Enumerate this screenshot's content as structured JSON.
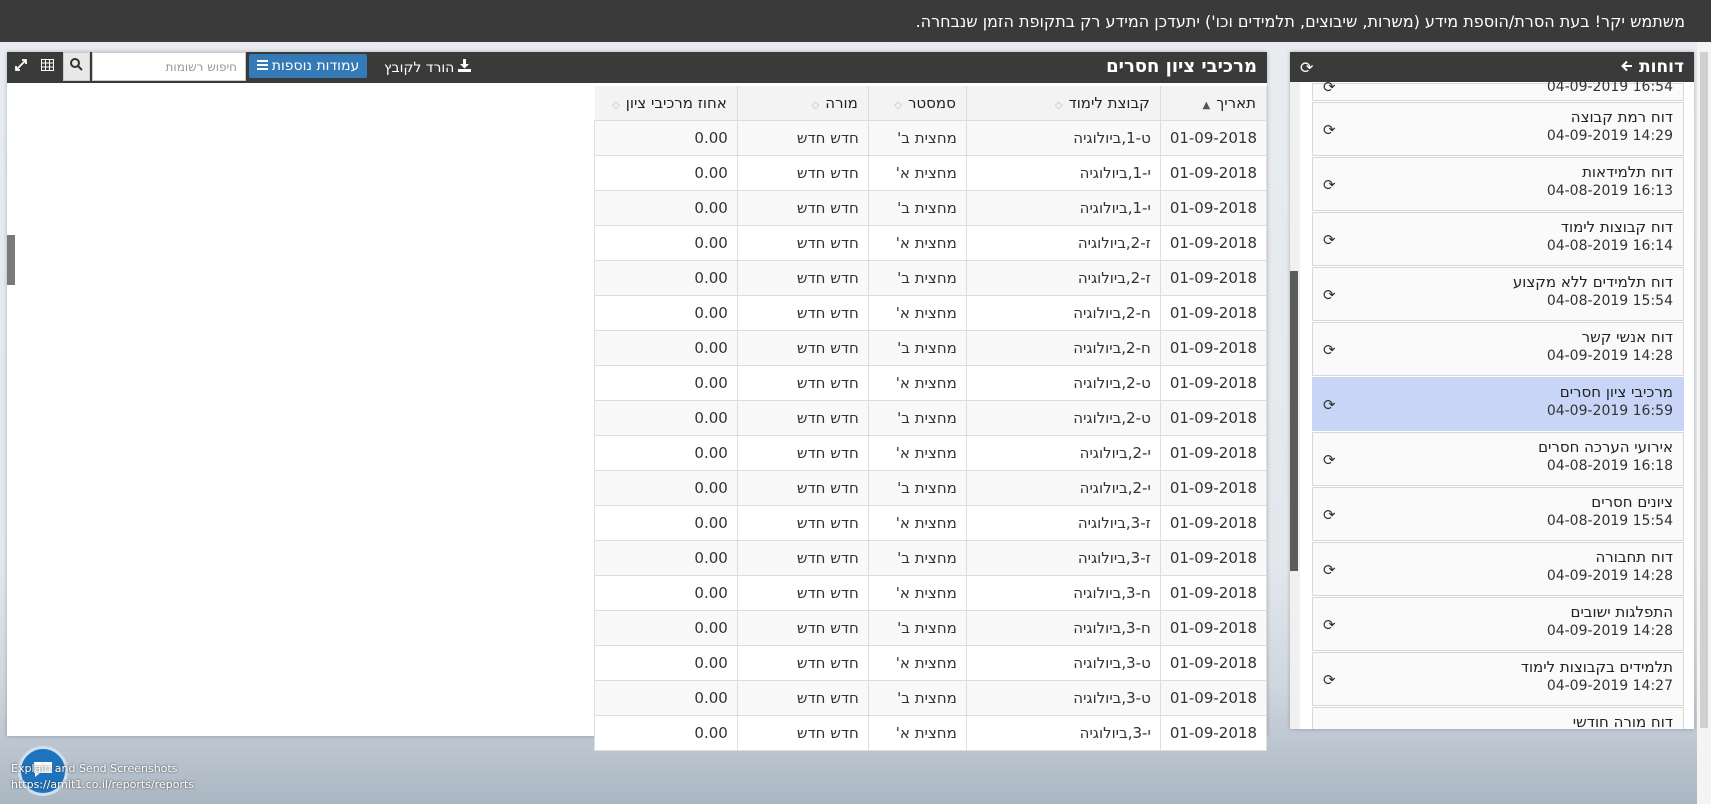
{
  "banner": {
    "text": "משתמש יקר! בעת הסרת/הוספת מידע (משרות, שיבוצים, תלמידים וכו') יתעדכן המידע רק בתקופת הזמן שנבחרה."
  },
  "reports_panel": {
    "title": "דוחות",
    "partial_top_date": "16:54 04-09-2019",
    "items": [
      {
        "name": "דוח רמת קבוצה",
        "date": "14:29 04-09-2019",
        "active": false
      },
      {
        "name": "דוח תלמידאות",
        "date": "16:13 04-08-2019",
        "active": false
      },
      {
        "name": "דוח קבוצות לימוד",
        "date": "16:14 04-08-2019",
        "active": false
      },
      {
        "name": "דוח תלמידים ללא מקצוע",
        "date": "15:54 04-08-2019",
        "active": false
      },
      {
        "name": "דוח אנשי קשר",
        "date": "14:28 04-09-2019",
        "active": false
      },
      {
        "name": "מרכיבי ציון חסרים",
        "date": "16:59 04-09-2019",
        "active": true
      },
      {
        "name": "אירועי הערכה חסרים",
        "date": "16:18 04-08-2019",
        "active": false
      },
      {
        "name": "ציונים חסרים",
        "date": "15:54 04-08-2019",
        "active": false
      },
      {
        "name": "דוח תחבורה",
        "date": "14:28 04-09-2019",
        "active": false
      },
      {
        "name": "התפלגות ישובים",
        "date": "14:28 04-09-2019",
        "active": false
      },
      {
        "name": "תלמידים בקבוצות לימוד",
        "date": "14:27 04-09-2019",
        "active": false
      },
      {
        "name": "דוח מורה חודשי",
        "date": "",
        "active": false
      }
    ]
  },
  "grid": {
    "title": "מרכיבי ציון חסרים",
    "download_label": "הורד לקובץ",
    "more_columns_label": "עמודות נוספות",
    "search_placeholder": "חיפוש רשומות",
    "columns": [
      "תאריך",
      "קבוצת לימוד",
      "סמסטר",
      "מורה",
      "אחוז מרכיבי ציון"
    ],
    "rows": [
      [
        "01-09-2018",
        "ט-1,ביולוגיה",
        "מחצית ב'",
        "חדש חדש",
        "0.00"
      ],
      [
        "01-09-2018",
        "י-1,ביולוגיה",
        "מחצית א'",
        "חדש חדש",
        "0.00"
      ],
      [
        "01-09-2018",
        "י-1,ביולוגיה",
        "מחצית ב'",
        "חדש חדש",
        "0.00"
      ],
      [
        "01-09-2018",
        "ז-2,ביולוגיה",
        "מחצית א'",
        "חדש חדש",
        "0.00"
      ],
      [
        "01-09-2018",
        "ז-2,ביולוגיה",
        "מחצית ב'",
        "חדש חדש",
        "0.00"
      ],
      [
        "01-09-2018",
        "ח-2,ביולוגיה",
        "מחצית א'",
        "חדש חדש",
        "0.00"
      ],
      [
        "01-09-2018",
        "ח-2,ביולוגיה",
        "מחצית ב'",
        "חדש חדש",
        "0.00"
      ],
      [
        "01-09-2018",
        "ט-2,ביולוגיה",
        "מחצית א'",
        "חדש חדש",
        "0.00"
      ],
      [
        "01-09-2018",
        "ט-2,ביולוגיה",
        "מחצית ב'",
        "חדש חדש",
        "0.00"
      ],
      [
        "01-09-2018",
        "י-2,ביולוגיה",
        "מחצית א'",
        "חדש חדש",
        "0.00"
      ],
      [
        "01-09-2018",
        "י-2,ביולוגיה",
        "מחצית ב'",
        "חדש חדש",
        "0.00"
      ],
      [
        "01-09-2018",
        "ז-3,ביולוגיה",
        "מחצית א'",
        "חדש חדש",
        "0.00"
      ],
      [
        "01-09-2018",
        "ז-3,ביולוגיה",
        "מחצית ב'",
        "חדש חדש",
        "0.00"
      ],
      [
        "01-09-2018",
        "ח-3,ביולוגיה",
        "מחצית א'",
        "חדש חדש",
        "0.00"
      ],
      [
        "01-09-2018",
        "ח-3,ביולוגיה",
        "מחצית ב'",
        "חדש חדש",
        "0.00"
      ],
      [
        "01-09-2018",
        "ט-3,ביולוגיה",
        "מחצית א'",
        "חדש חדש",
        "0.00"
      ],
      [
        "01-09-2018",
        "ט-3,ביולוגיה",
        "מחצית ב'",
        "חדש חדש",
        "0.00"
      ],
      [
        "01-09-2018",
        "י-3,ביולוגיה",
        "מחצית א'",
        "חדש חדש",
        "0.00"
      ]
    ]
  },
  "overlay": {
    "label": "Explain and Send Screenshots",
    "url": "https://amit1.co.il/reports/reports"
  },
  "colors": {
    "header_bg": "#3a3a3a",
    "active_item": "#c9d5f7",
    "primary_button": "#337ab7"
  },
  "icons": {
    "refresh": "refresh-icon",
    "back_arrow": "arrow-left-icon",
    "download": "download-icon",
    "menu": "list-icon",
    "search": "search-icon",
    "grid": "grid-icon",
    "expand": "expand-icon"
  }
}
